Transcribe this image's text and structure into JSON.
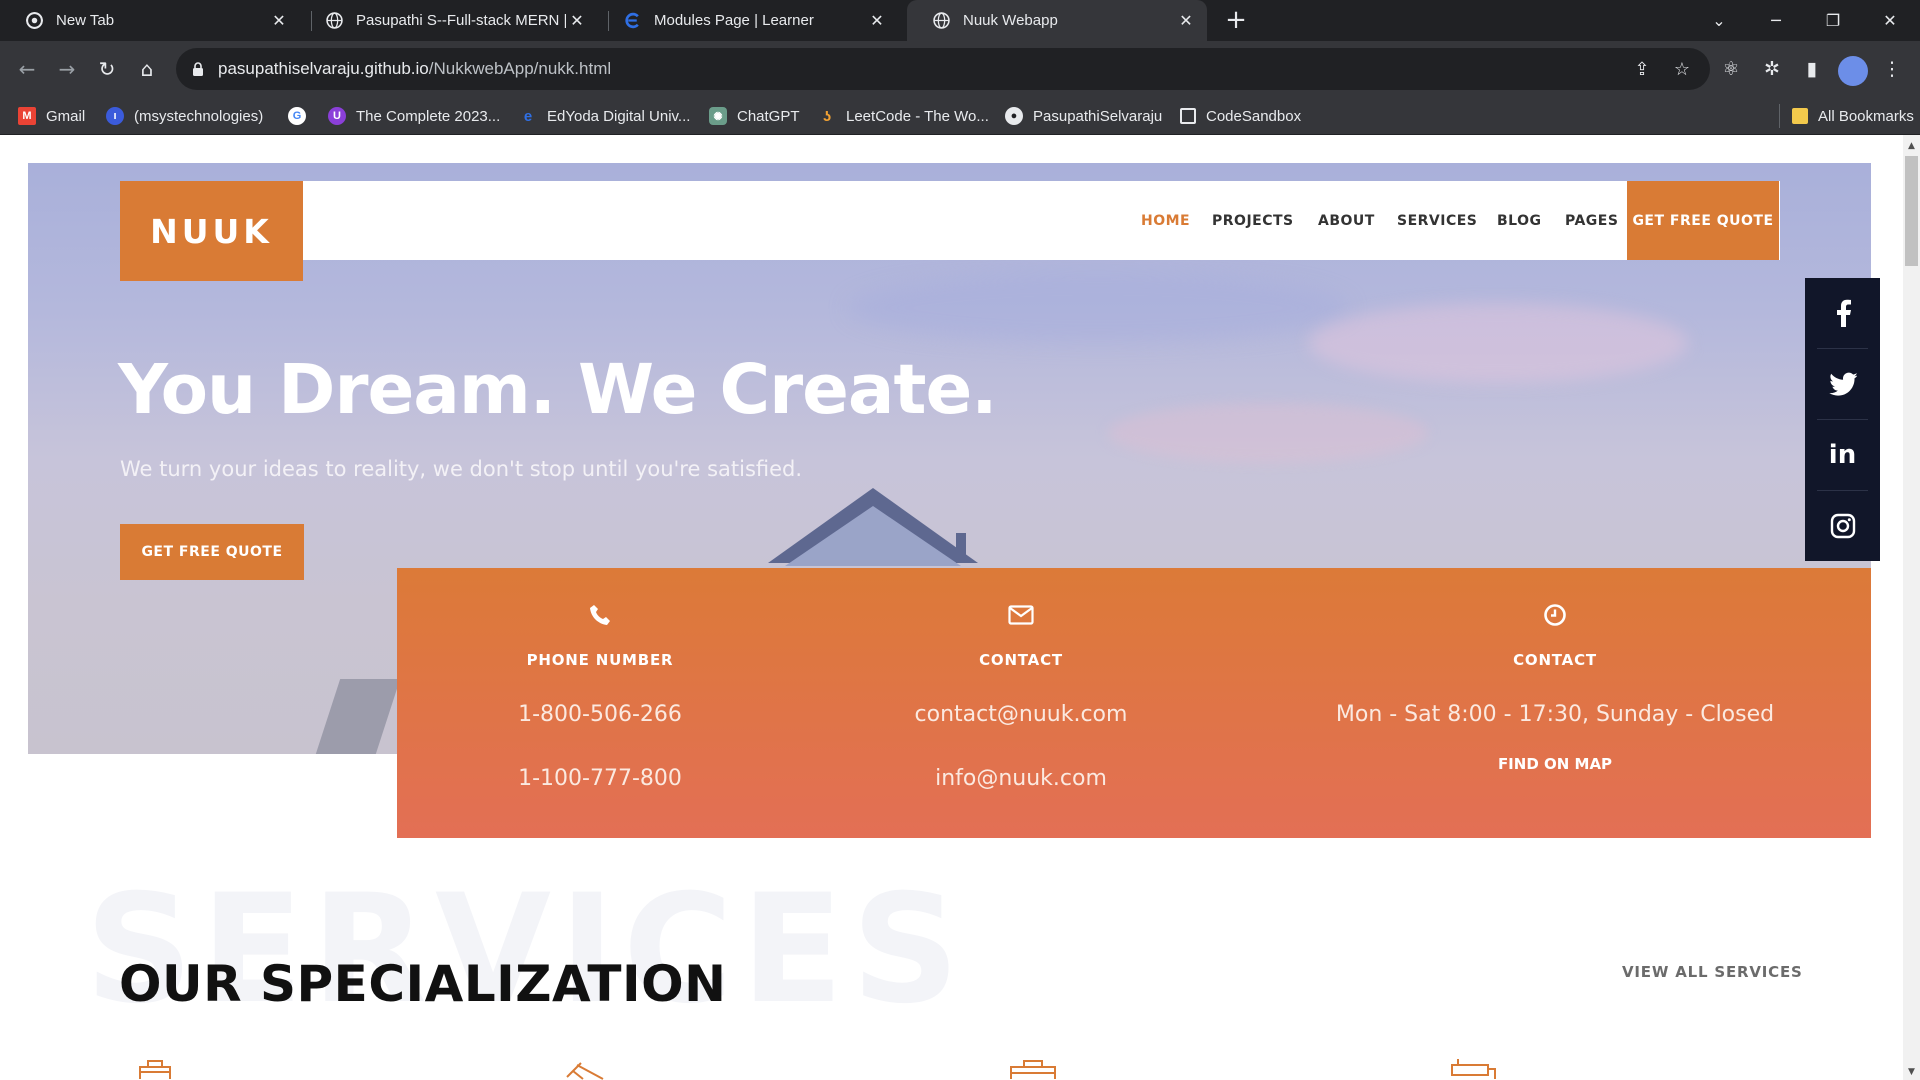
{
  "browser": {
    "tabs": [
      {
        "title": "New Tab",
        "favicon_color": "#e8eaed"
      },
      {
        "title": "Pasupathi S--Full-stack MERN ||",
        "favicon_color": "#e8eaed"
      },
      {
        "title": "Modules Page | Learner",
        "favicon_color": "#2f6fe4"
      },
      {
        "title": "Nuuk Webapp",
        "favicon_color": "#e8eaed",
        "active": true
      }
    ],
    "new_tab_icon": "plus-icon",
    "address_bar": {
      "host": "pasupathiselvaraju.github.io",
      "path": "/NukkwebApp/nukk.html"
    },
    "bookmarks": [
      {
        "label": "Gmail",
        "icon_color": "#ea4335"
      },
      {
        "label": "(msystechnologies)",
        "icon_color": "#3b5bdb"
      },
      {
        "label": "",
        "icon_color": "#ffffff"
      },
      {
        "label": "The Complete 2023...",
        "icon_color": "#8b3fd9"
      },
      {
        "label": "EdYoda Digital Univ...",
        "icon_color": "#2f6fe4"
      },
      {
        "label": "ChatGPT",
        "icon_color": "#6b9d8a"
      },
      {
        "label": "LeetCode - The Wo...",
        "icon_color": "#f0a133"
      },
      {
        "label": "PasupathiSelvaraju",
        "icon_color": "#e8eaed"
      },
      {
        "label": "CodeSandbox",
        "icon_color": "#e8eaed"
      }
    ],
    "all_bookmarks": "All Bookmarks"
  },
  "site": {
    "logo": "NUUK",
    "nav": [
      "HOME",
      "PROJECTS",
      "ABOUT",
      "SERVICES",
      "BLOG",
      "PAGES"
    ],
    "nav_cta": "GET FREE QUOTE",
    "hero": {
      "title": "You Dream. We Create.",
      "subtitle": "We turn your ideas to reality, we don't stop until you're satisfied.",
      "button": "GET FREE QUOTE"
    },
    "social": [
      "f",
      "twitter",
      "in",
      "instagram"
    ],
    "info": [
      {
        "label": "PHONE NUMBER",
        "v1": "1-800-506-266",
        "v2": "1-100-777-800"
      },
      {
        "label": "CONTACT",
        "v1": "contact@nuuk.com",
        "v2": "info@nuuk.com"
      },
      {
        "label": "CONTACT",
        "v1": "Mon - Sat 8:00 - 17:30, Sunday - Closed",
        "link": "FIND ON MAP"
      }
    ],
    "services_watermark": "SERVICES",
    "section_title": "OUR SPECIALIZATION",
    "view_all": "VIEW ALL SERVICES"
  },
  "colors": {
    "accent": "#d97b35",
    "dark": "#111629",
    "chrome_bg": "#202124",
    "chrome_toolbar": "#35363a"
  }
}
